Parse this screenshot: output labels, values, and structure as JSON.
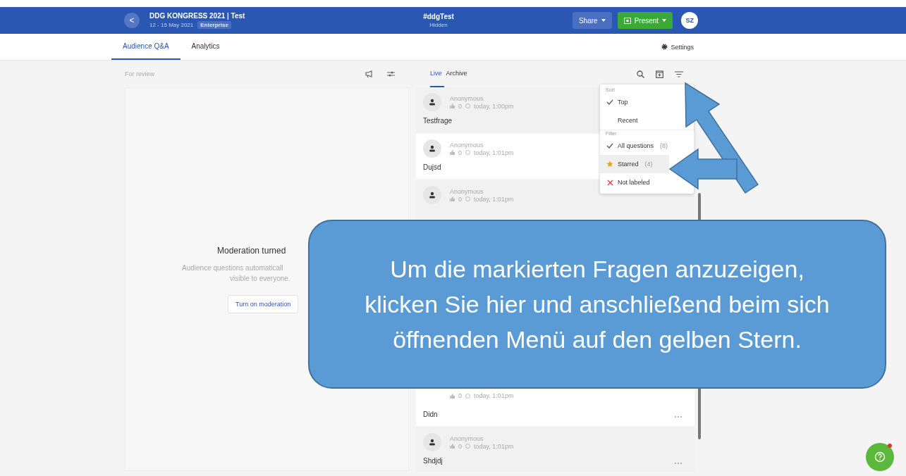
{
  "header": {
    "back": "<",
    "event_title": "DDG KONGRESS 2021 | Test",
    "event_dates": "12 - 15 May 2021",
    "plan_badge": "Enterprise",
    "channel": "#ddgTest",
    "channel_status": "Hidden",
    "share": "Share",
    "present": "Present",
    "avatar": "SZ"
  },
  "tabs": [
    {
      "label": "Audience Q&A",
      "selected": true
    },
    {
      "label": "Analytics",
      "selected": false
    }
  ],
  "settings": "Settings",
  "review": {
    "title": "For review",
    "empty_title": "Moderation turned",
    "empty_text_1": "Audience questions automaticall",
    "empty_text_2": "visible to everyone.",
    "button": "Turn on moderation"
  },
  "list_tabs": [
    {
      "label": "Live",
      "selected": true
    },
    {
      "label": "Archive",
      "selected": false
    }
  ],
  "questions": [
    {
      "author": "Anonymous",
      "votes": "0",
      "time": "today, 1:00pm",
      "text": "Testfrage",
      "highlighted": false
    },
    {
      "author": "Anonymous",
      "votes": "0",
      "time": "today, 1:01pm",
      "text": "Dujsd",
      "highlighted": true
    },
    {
      "author": "Anonymous",
      "votes": "0",
      "time": "today, 1:01pm",
      "highlighted": false
    },
    {
      "votes": "0",
      "time": "today, 1:01pm",
      "text": "Didn",
      "highlighted": true
    },
    {
      "author": "Anonymous",
      "votes": "0",
      "time": "today, 1:01pm",
      "text": "Shdjdj",
      "highlighted": false
    }
  ],
  "menu": {
    "sort_title": "Sort",
    "sort": [
      {
        "label": "Top",
        "checked": true
      },
      {
        "label": "Recent",
        "checked": false
      }
    ],
    "filter_title": "Filter",
    "filter": [
      {
        "kind": "all",
        "label": "All questions",
        "count": "(8)",
        "checked": true,
        "highlighted": false
      },
      {
        "kind": "starred",
        "label": "Starred",
        "count": "(4)",
        "checked": false,
        "highlighted": true
      },
      {
        "kind": "unlabeled",
        "label": "Not labeled",
        "checked": false,
        "highlighted": false
      }
    ]
  },
  "callout": "Um die markierten Fragen anzuzeigen, klicken Sie hier und anschließend beim sich öffnenden Menü auf den gelben Stern."
}
